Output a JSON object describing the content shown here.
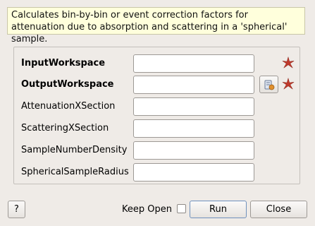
{
  "description": "Calculates bin-by-bin or event correction factors for attenuation due to absorption and scattering in a 'spherical' sample.",
  "properties": [
    {
      "label": "InputWorkspace",
      "value": "",
      "required": true
    },
    {
      "label": "OutputWorkspace",
      "value": "",
      "required": true,
      "browse_icon": "workspace-browse-icon"
    },
    {
      "label": "AttenuationXSection",
      "value": "",
      "required": false
    },
    {
      "label": "ScatteringXSection",
      "value": "",
      "required": false
    },
    {
      "label": "SampleNumberDensity",
      "value": "",
      "required": false
    },
    {
      "label": "SphericalSampleRadius",
      "value": "",
      "required": false
    }
  ],
  "footer": {
    "help_label": "?",
    "keep_open_label": "Keep Open",
    "keep_open_checked": false,
    "run_label": "Run",
    "close_label": "Close"
  },
  "colors": {
    "required_star": "#c0392b",
    "description_bg": "#ffffdc",
    "window_bg": "#efebe7"
  }
}
